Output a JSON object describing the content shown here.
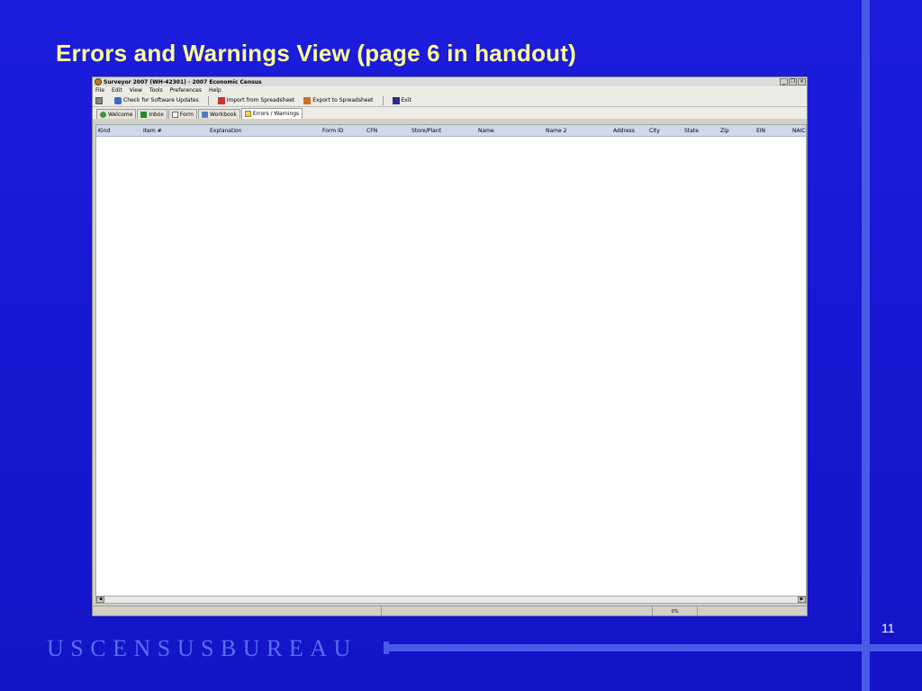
{
  "slide": {
    "title": "Errors and Warnings View (page 6 in handout)",
    "number": "11",
    "footer_brand": "USCENSUSBUREAU"
  },
  "window": {
    "title": "Surveyor 2007 (WH-42301) - 2007 Economic Census",
    "controls": {
      "minimize": "_",
      "restore": "❐",
      "close": "×"
    }
  },
  "menu": [
    "File",
    "Edit",
    "View",
    "Tools",
    "Preferences",
    "Help"
  ],
  "toolbar": {
    "check_updates": "Check for Software Updates",
    "import": "Import from Spreadsheet",
    "export": "Export to Spreadsheet",
    "exit": "Exit"
  },
  "tabs": [
    "Welcome",
    "Inbox",
    "Form",
    "Workbook",
    "Errors / Warnings"
  ],
  "columns": [
    "Kind",
    "Item #",
    "Explanation",
    "Form ID",
    "CFN",
    "Store/Plant",
    "Name",
    "Name 2",
    "Address",
    "City",
    "State",
    "Zip",
    "EIN",
    "NAIC"
  ],
  "status": {
    "progress": "0%"
  },
  "colors": {
    "background": "#1a1ad9",
    "title": "#ffff99",
    "accent_line": "#4a5ae8"
  }
}
